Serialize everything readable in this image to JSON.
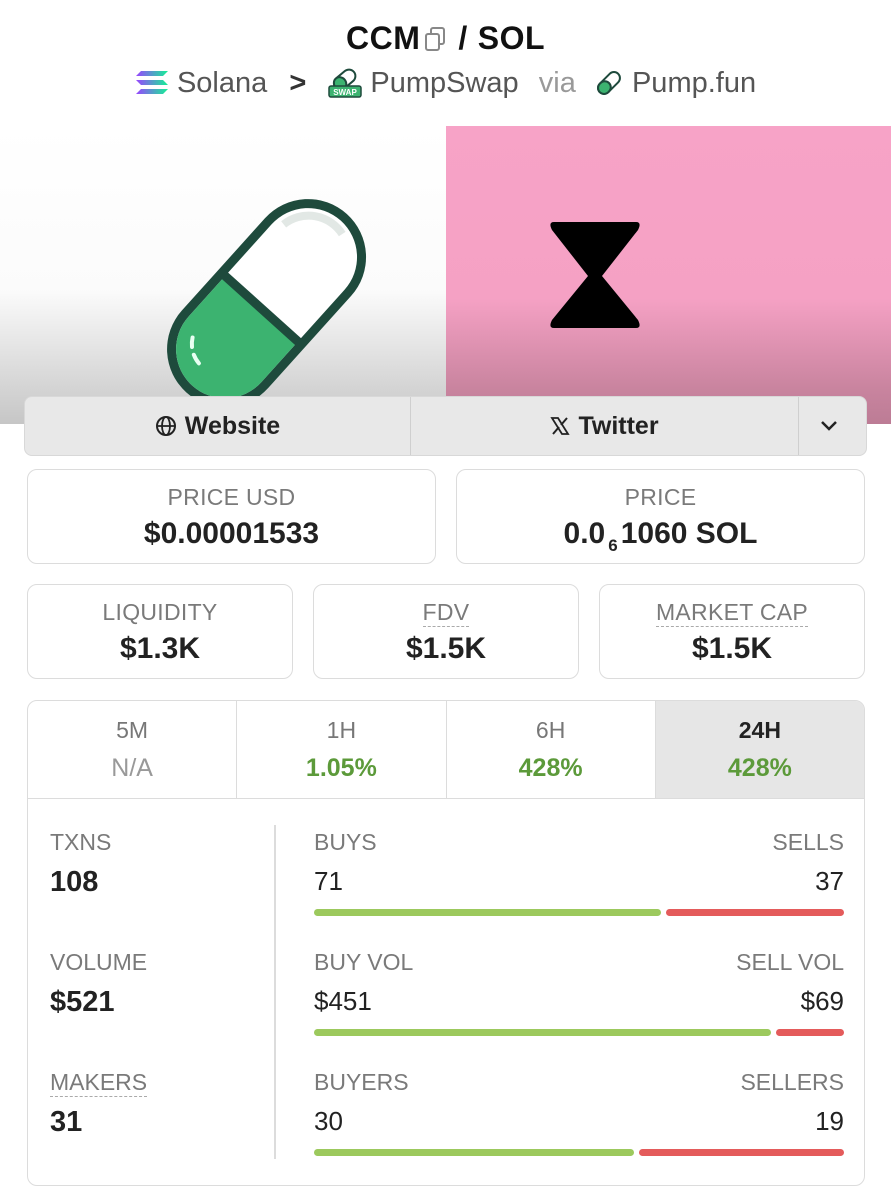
{
  "header": {
    "base_symbol": "CCM",
    "quote_symbol": "SOL",
    "chain": "Solana",
    "dex": "PumpSwap",
    "via_label": "via",
    "launchpad": "Pump.fun",
    "separator": "/",
    "crumb_separator": ">",
    "dex_badge_text": "SWAP"
  },
  "links": {
    "website_label": "Website",
    "twitter_label": "Twitter"
  },
  "price": {
    "usd_label": "PRICE USD",
    "usd_value": "$0.00001533",
    "native_label": "PRICE",
    "native_prefix": "0.0",
    "native_subscript": "6",
    "native_suffix": "1060 SOL"
  },
  "metrics": {
    "liquidity_label": "LIQUIDITY",
    "liquidity_value": "$1.3K",
    "fdv_label": "FDV",
    "fdv_value": "$1.5K",
    "mcap_label": "MARKET CAP",
    "mcap_value": "$1.5K"
  },
  "periods": [
    {
      "label": "5M",
      "value": "N/A"
    },
    {
      "label": "1H",
      "value": "1.05%"
    },
    {
      "label": "6H",
      "value": "428%"
    },
    {
      "label": "24H",
      "value": "428%"
    }
  ],
  "active_period": "24H",
  "stats": {
    "txns_label": "TXNS",
    "txns_value": "108",
    "volume_label": "VOLUME",
    "volume_value": "$521",
    "makers_label": "MAKERS",
    "makers_value": "31",
    "buys_label": "BUYS",
    "buys_value": "71",
    "sells_label": "SELLS",
    "sells_value": "37",
    "buy_vol_label": "BUY VOL",
    "buy_vol_value": "$451",
    "sell_vol_label": "SELL VOL",
    "sell_vol_value": "$69",
    "buyers_label": "BUYERS",
    "buyers_value": "30",
    "sellers_label": "SELLERS",
    "sellers_value": "19"
  },
  "ratios": {
    "buys_fraction": 0.66,
    "buy_vol_fraction": 0.87,
    "buyers_fraction": 0.61
  },
  "colors": {
    "positive": "#5c9a3a",
    "bar_green": "#9cc95d",
    "bar_red": "#e45b5b",
    "banner_pink": "#f7a3c7",
    "pill_green": "#3cb370",
    "pill_outline": "#1e4a3c"
  }
}
